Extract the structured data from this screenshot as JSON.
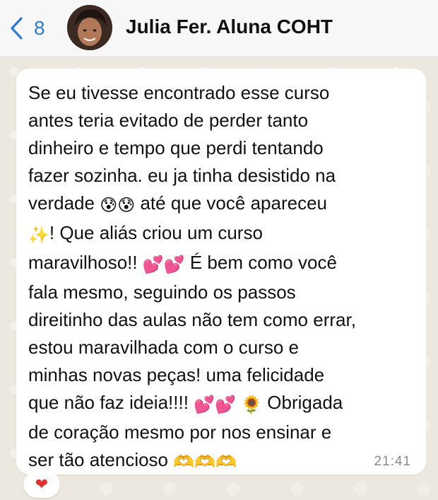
{
  "header": {
    "back_count": "8",
    "contact_name": "Julia Fer. Aluna COHT"
  },
  "message": {
    "line1": "Se eu tivesse encontrado esse curso",
    "line2": "antes teria evitado de perder tanto",
    "line3": "dinheiro e tempo que perdi tentando",
    "line4": "fazer sozinha. eu ja tinha desistido na",
    "line5a": "verdade ",
    "line5b": " até que você apareceu",
    "line6": "! Que aliás criou um curso",
    "line7a": "maravilhoso!! ",
    "line7b": " É bem como você",
    "line8": "fala mesmo, seguindo os passos",
    "line9": "direitinho das aulas não tem como errar,",
    "line10": "estou maravilhada com o curso e",
    "line11": "minhas novas peças! uma felicidade",
    "line12a": "que não faz ideia!!!! ",
    "line12b": " Obrigada",
    "line13": "de coração mesmo por nos ensinar e",
    "line14": "ser tão atencioso ",
    "emoji_sad": "😰😰",
    "emoji_sparkles": "✨",
    "emoji_hearts": "💕💕",
    "emoji_sunflower": "🌻",
    "emoji_hands": "🫶🫶🫶",
    "time": "21:41",
    "reaction": "❤"
  }
}
